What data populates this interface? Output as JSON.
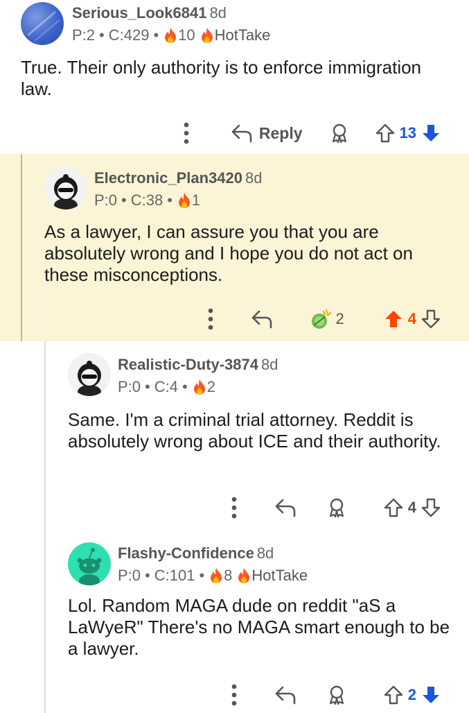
{
  "comments": [
    {
      "username": "Serious_Look6841",
      "age": "8d",
      "stats": {
        "p": "P:2",
        "c": "C:429",
        "fire": "10",
        "flair": "HotTake"
      },
      "body": "True. Their only authority is to enforce immigration law.",
      "actions": {
        "reply": "Reply",
        "votes": "13",
        "vote_state": "downvoted"
      }
    },
    {
      "username": "Electronic_Plan3420",
      "age": "8d",
      "stats": {
        "p": "P:0",
        "c": "C:38",
        "fire": "1"
      },
      "body": "As a lawyer, I can assure you that you are absolutely wrong and I hope you do not act on these misconceptions.",
      "actions": {
        "awards": "2",
        "votes": "4",
        "vote_state": "upvoted"
      }
    },
    {
      "username": "Realistic-Duty-3874",
      "age": "8d",
      "stats": {
        "p": "P:0",
        "c": "C:4",
        "fire": "2"
      },
      "body": "Same. I'm a criminal trial attorney. Reddit is absolutely wrong about ICE and their authority.",
      "actions": {
        "votes": "4",
        "vote_state": "none"
      }
    },
    {
      "username": "Flashy-Confidence",
      "age": "8d",
      "stats": {
        "p": "P:0",
        "c": "C:101",
        "fire": "8",
        "flair": "HotTake"
      },
      "body": "Lol. Random MAGA dude on reddit \"aS a LaWyeR\" There's no MAGA smart enough to be a lawyer.",
      "actions": {
        "votes": "2",
        "vote_state": "downvoted"
      }
    }
  ],
  "colors": {
    "upvote": "#ff4500",
    "downvote": "#1a56db",
    "highlight": "#fbf4d6",
    "fire": "#ff5722"
  },
  "icons": [
    "more-icon",
    "reply-icon",
    "award-icon",
    "upvote-icon",
    "downvote-icon",
    "fire-icon"
  ]
}
